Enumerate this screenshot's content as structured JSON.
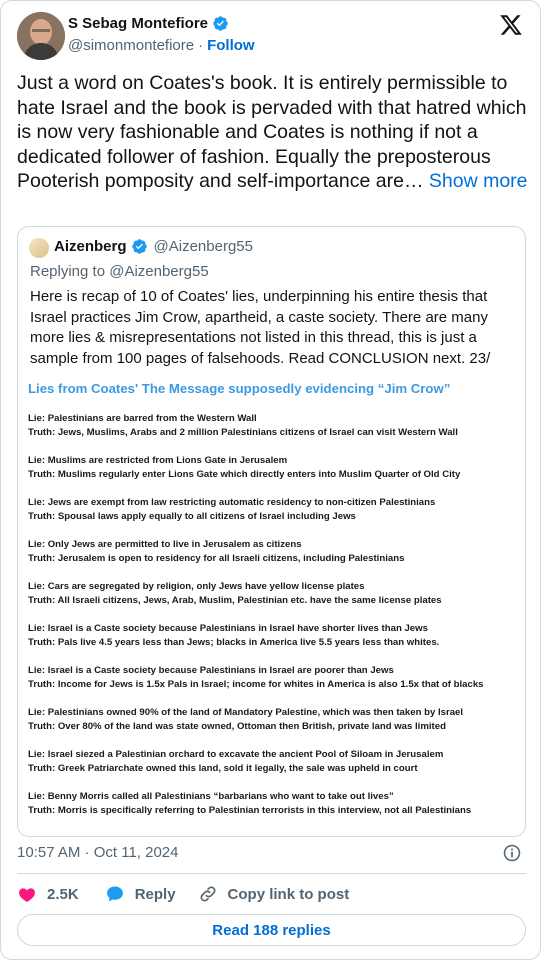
{
  "author": {
    "name": "S Sebag Montefiore",
    "handle": "@simonmontefiore",
    "separator": "·",
    "follow_label": "Follow"
  },
  "tweet": {
    "text": "Just a word on Coates's book.   It is entirely permissible to hate Israel and the book is pervaded with that hatred which is now very fashionable and Coates is nothing if not a dedicated follower of fashion. Equally the preposterous Pooterish pomposity and self-importance are…",
    "show_more_label": "Show more"
  },
  "quoted": {
    "name": "Aizenberg",
    "handle": "@Aizenberg55",
    "replying_to": "Replying to @Aizenberg55",
    "text": "Here is recap of 10 of Coates' lies, underpinning his entire thesis that Israel practices Jim Crow, apartheid, a caste society. There are many more lies & misrepresentations not listed in this thread, this is just a sample from 100 pages of falsehoods. Read CONCLUSION next. 23/",
    "image": {
      "title": "Lies from Coates' The Message supposedly evidencing “Jim Crow”",
      "items": [
        {
          "lie": "Lie: Palestinians are barred from the Western Wall",
          "truth": "Truth: Jews, Muslims, Arabs and 2 million Palestinians citizens of Israel can visit Western Wall"
        },
        {
          "lie": "Lie: Muslims are restricted from Lions Gate in Jerusalem",
          "truth": "Truth: Muslims regularly enter Lions Gate which directly enters into Muslim Quarter of Old City"
        },
        {
          "lie": "Lie: Jews are exempt from law restricting automatic residency to non-citizen Palestinians",
          "truth": "Truth: Spousal laws apply equally to all citizens of Israel including Jews"
        },
        {
          "lie": "Lie: Only Jews are permitted to live in Jerusalem as citizens",
          "truth": "Truth: Jerusalem is open to residency for all Israeli citizens, including Palestinians"
        },
        {
          "lie": "Lie: Cars are segregated by religion, only Jews have yellow license plates",
          "truth": "Truth: All Israeli citizens, Jews, Arab, Muslim, Palestinian etc. have the same license plates"
        },
        {
          "lie": "Lie: Israel is a Caste society because Palestinians in Israel have shorter lives than Jews",
          "truth": "Truth: Pals live 4.5 years less than Jews; blacks in America live 5.5 years less than whites."
        },
        {
          "lie": "Lie: Israel is a Caste society because Palestinians in Israel are poorer than Jews",
          "truth": "Truth: Income for Jews is 1.5x Pals in Israel; income for whites in America is also 1.5x that of blacks"
        },
        {
          "lie": "Lie: Palestinians owned 90% of the land of Mandatory Palestine, which was then taken by Israel",
          "truth": "Truth: Over 80% of the land was state owned, Ottoman then British, private land was limited"
        },
        {
          "lie": "Lie: Israel siezed a Palestinian orchard to excavate the ancient Pool of Siloam in Jerusalem",
          "truth": "Truth: Greek Patriarchate owned this land, sold it legally, the sale was upheld in court"
        },
        {
          "lie": "Lie: Benny Morris called all Palestinians “barbarians who want to take out lives”",
          "truth": "Truth: Morris is specifically referring to Palestinian terrorists in this interview, not all Palestinians"
        }
      ]
    }
  },
  "meta": {
    "timestamp": "10:57 AM · Oct 11, 2024"
  },
  "actions": {
    "likes": "2.5K",
    "reply_label": "Reply",
    "copy_label": "Copy link to post",
    "read_replies_label": "Read 188 replies"
  },
  "colors": {
    "link": "#006fd6",
    "like": "#f91880",
    "secondary_text": "#536471",
    "border": "#cfd9de",
    "verified": "#1d9bf0",
    "image_title": "#3b9ae1"
  },
  "icons": [
    "x-logo-icon",
    "verified-badge-icon",
    "info-icon",
    "heart-icon",
    "reply-bubble-icon",
    "link-icon"
  ]
}
